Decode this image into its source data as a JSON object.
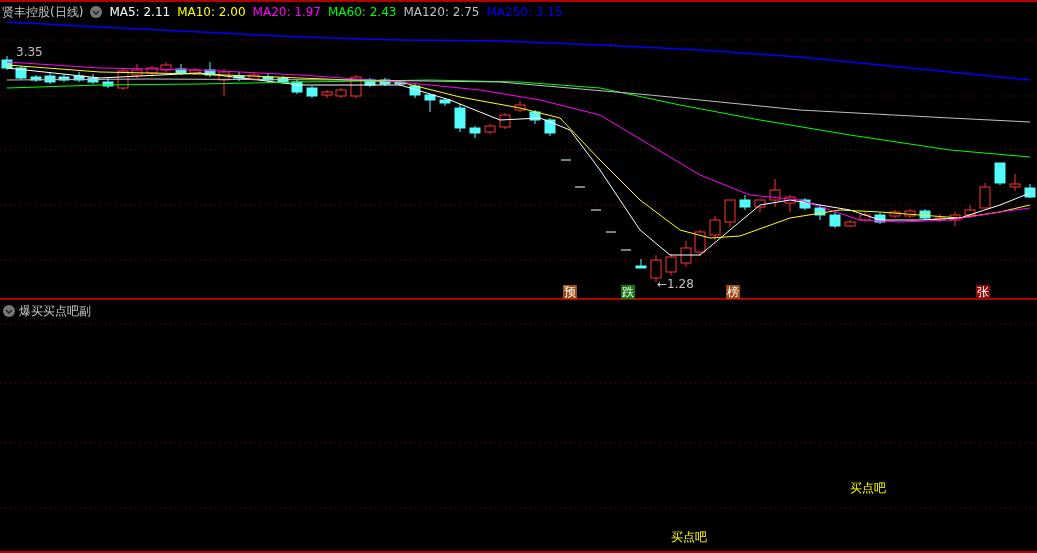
{
  "main_panel": {
    "title": "贤丰控股(日线)",
    "indicators": [
      {
        "label": "MA5: 2.11",
        "color": "#ffffff"
      },
      {
        "label": "MA10: 2.00",
        "color": "#ffff00"
      },
      {
        "label": "MA20: 1.97",
        "color": "#ff00ff"
      },
      {
        "label": "MA60: 2.43",
        "color": "#00ff00"
      },
      {
        "label": "MA120: 2.75",
        "color": "#c0c0c0"
      },
      {
        "label": "MA250: 3.15",
        "color": "#0000ff"
      }
    ],
    "price_labels": [
      {
        "text": "3.35"
      },
      {
        "text": "←1.28"
      }
    ],
    "event_tags": [
      {
        "text": "预",
        "color": "#9c4a14"
      },
      {
        "text": "跌",
        "color": "#117a11"
      },
      {
        "text": "榜",
        "color": "#9c4a14"
      },
      {
        "text": "张",
        "color": "#8a0c0c"
      }
    ]
  },
  "sub_panel": {
    "title": "爆买买点吧副",
    "signals": [
      {
        "text": "买点吧"
      },
      {
        "text": "买点吧"
      }
    ]
  }
}
